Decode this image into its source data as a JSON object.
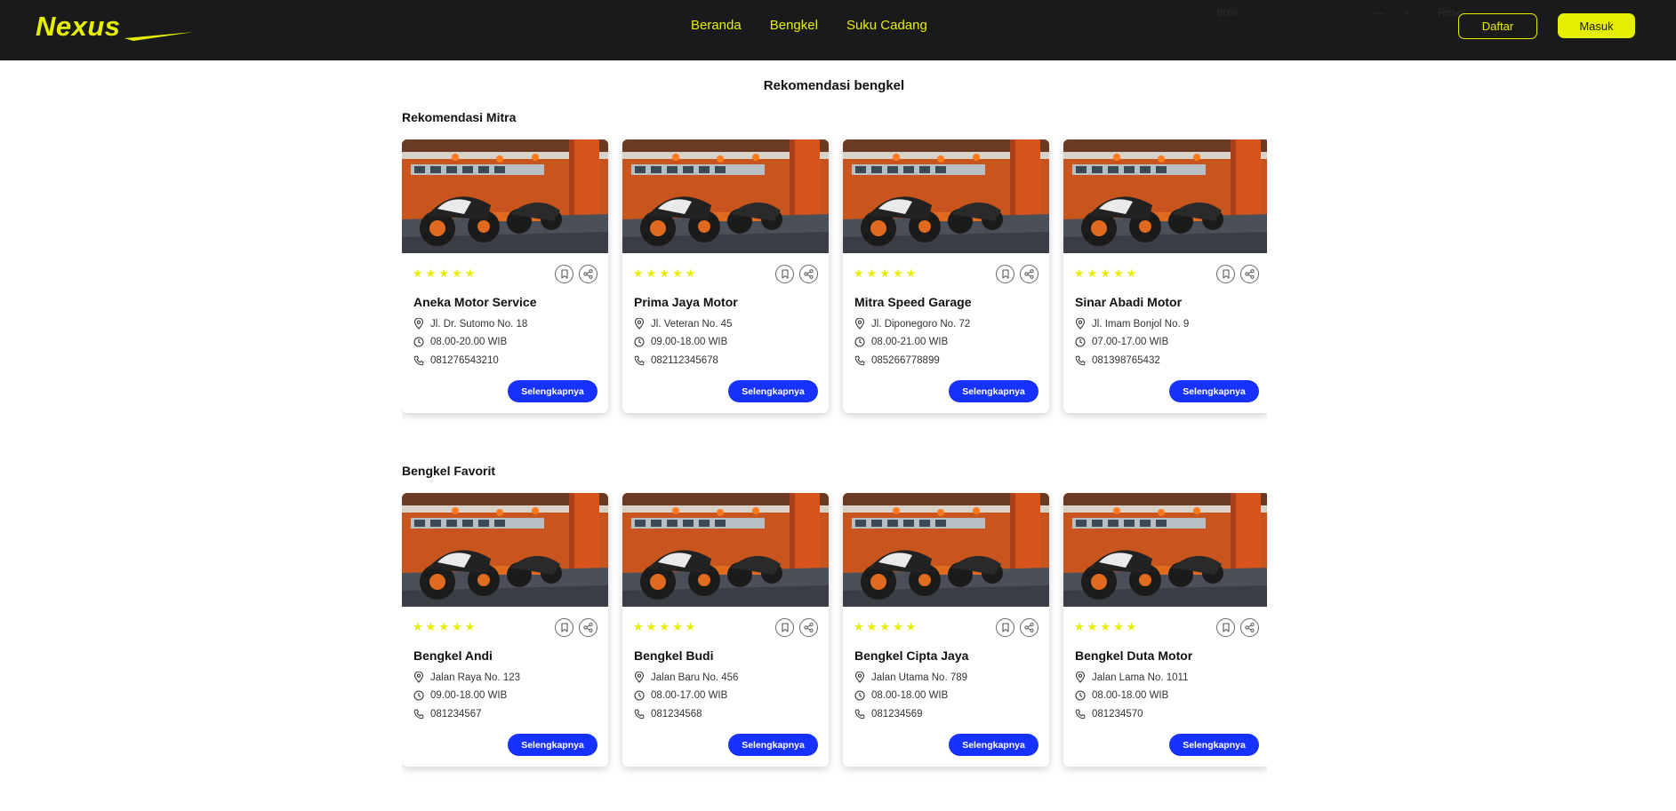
{
  "header": {
    "logo": "Nexus",
    "nav": [
      "Beranda",
      "Bengkel",
      "Suku Cadang"
    ],
    "ghost": {
      "zoom": "80%",
      "minus": "—",
      "plus": "+",
      "reset": "Reset"
    },
    "daftar_label": "Daftar",
    "masuk_label": "Masuk"
  },
  "colors": {
    "accent": "#e6ee00",
    "header_bg": "#1a1a1a",
    "button_blue": "#1732ff"
  },
  "page_title": "Rekomendasi bengkel",
  "sections": [
    {
      "title": "Rekomendasi Mitra",
      "cards": [
        {
          "name": "Aneka Motor Service",
          "address": "Jl. Dr. Sutomo No. 18",
          "hours": "08.00-20.00 WIB",
          "phone": "081276543210",
          "rating": 5,
          "button": "Selengkapnya"
        },
        {
          "name": "Prima Jaya Motor",
          "address": "Jl. Veteran No. 45",
          "hours": "09.00-18.00 WIB",
          "phone": "082112345678",
          "rating": 5,
          "button": "Selengkapnya"
        },
        {
          "name": "Mitra Speed Garage",
          "address": "Jl. Diponegoro No. 72",
          "hours": "08.00-21.00 WIB",
          "phone": "085266778899",
          "rating": 5,
          "button": "Selengkapnya"
        },
        {
          "name": "Sinar Abadi Motor",
          "address": "Jl. Imam Bonjol No. 9",
          "hours": "07.00-17.00 WIB",
          "phone": "081398765432",
          "rating": 5,
          "button": "Selengkapnya"
        }
      ]
    },
    {
      "title": "Bengkel Favorit",
      "cards": [
        {
          "name": "Bengkel Andi",
          "address": "Jalan Raya No. 123",
          "hours": "09.00-18.00 WIB",
          "phone": "081234567",
          "rating": 5,
          "button": "Selengkapnya"
        },
        {
          "name": "Bengkel Budi",
          "address": "Jalan Baru No. 456",
          "hours": "08.00-17.00 WIB",
          "phone": "081234568",
          "rating": 5,
          "button": "Selengkapnya"
        },
        {
          "name": "Bengkel Cipta Jaya",
          "address": "Jalan Utama No. 789",
          "hours": "08.00-18.00 WIB",
          "phone": "081234569",
          "rating": 5,
          "button": "Selengkapnya"
        },
        {
          "name": "Bengkel Duta Motor",
          "address": "Jalan Lama No. 1011",
          "hours": "08.00-18.00 WIB",
          "phone": "081234570",
          "rating": 5,
          "button": "Selengkapnya"
        }
      ]
    }
  ]
}
